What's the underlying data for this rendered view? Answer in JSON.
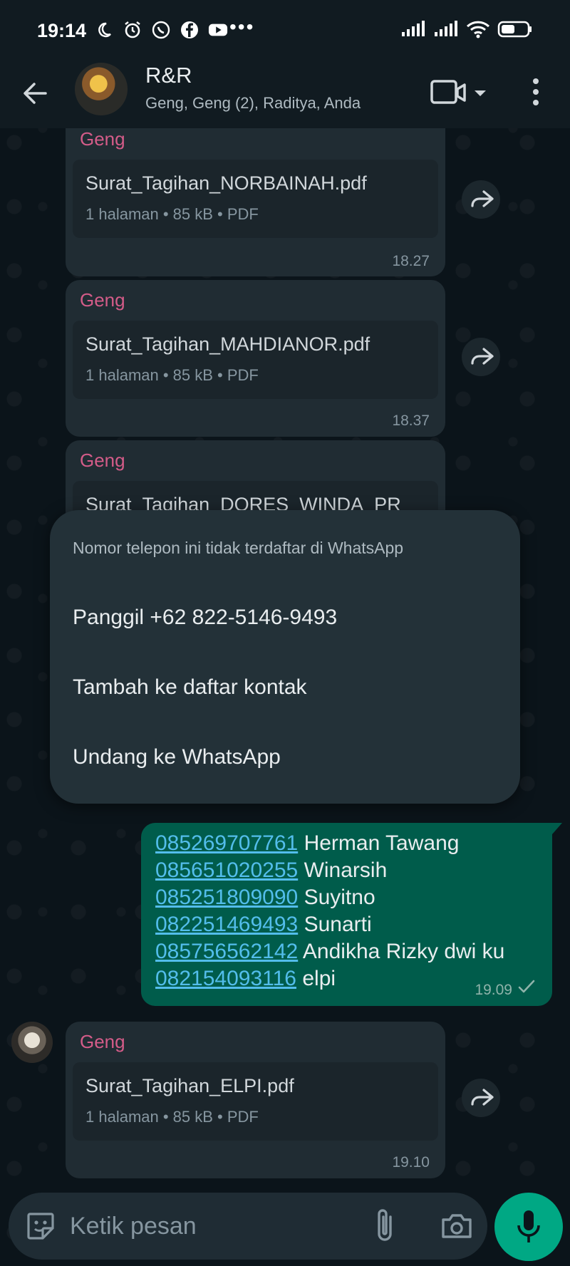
{
  "status_bar": {
    "time": "19:14"
  },
  "header": {
    "title": "R&R",
    "members": "Geng, Geng (2), Raditya, Anda"
  },
  "messages": [
    {
      "sender": "Geng",
      "file": "Surat_Tagihan_NORBAINAH.pdf",
      "meta": "1 halaman • 85 kB • PDF",
      "time": "18.27"
    },
    {
      "sender": "Geng",
      "file": "Surat_Tagihan_MAHDIANOR.pdf",
      "meta": "1 halaman • 85 kB • PDF",
      "time": "18.37"
    },
    {
      "sender": "Geng",
      "file": "Surat_Tagihan_DORES_WINDA_PR",
      "meta": "",
      "time": ""
    },
    {
      "sender": "Geng",
      "file": "Surat_Tagihan_ELPI.pdf",
      "meta": "1 halaman • 85 kB • PDF",
      "time": "19.10"
    }
  ],
  "dialog": {
    "message": "Nomor telepon ini tidak terdaftar di WhatsApp",
    "options": [
      "Panggil +62 822-5146-9493",
      "Tambah ke daftar kontak",
      "Undang ke WhatsApp"
    ]
  },
  "outgoing": {
    "lines": [
      {
        "phone": "085269707761",
        "name": "Herman Tawang"
      },
      {
        "phone": "085651020255",
        "name": "Winarsih"
      },
      {
        "phone": "085251809090",
        "name": "Suyitno"
      },
      {
        "phone": "082251469493",
        "name": "Sunarti"
      },
      {
        "phone": "085756562142",
        "name": "Andikha Rizky dwi ku"
      },
      {
        "phone": "082154093116",
        "name": "elpi"
      }
    ],
    "time": "19.09"
  },
  "input": {
    "placeholder": "Ketik pesan"
  }
}
